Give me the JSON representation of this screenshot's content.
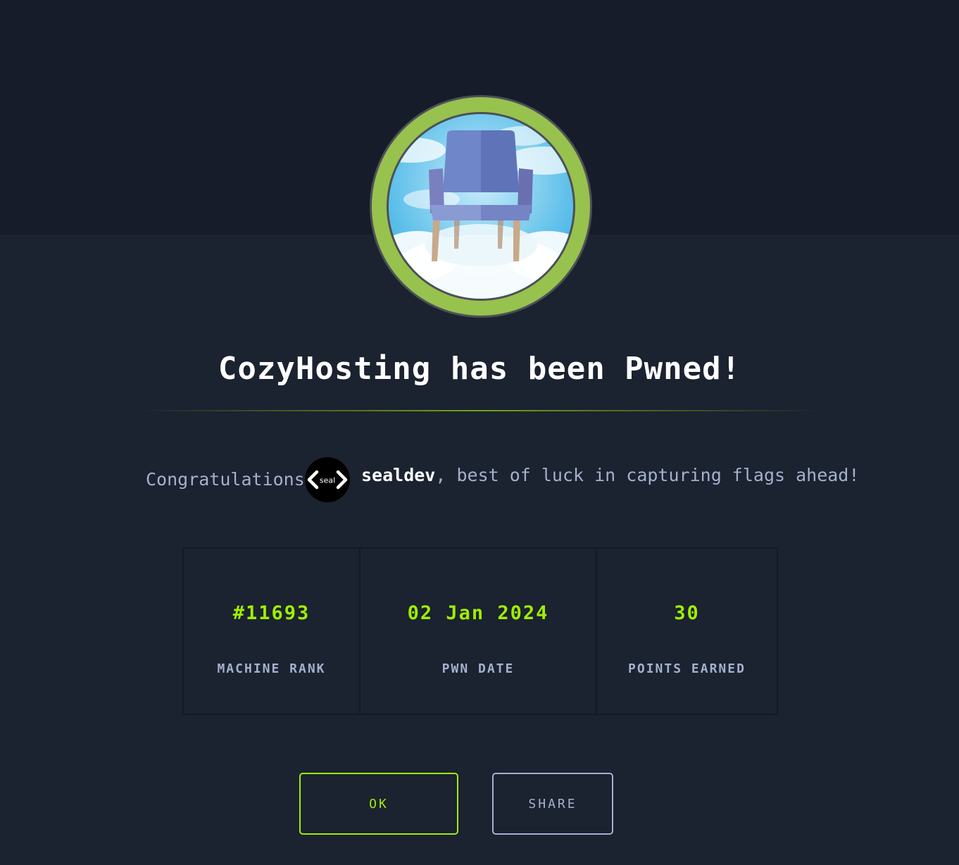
{
  "title": "CozyHosting has been Pwned!",
  "congrats": {
    "prefix": "Congratulations",
    "avatar_text": "seal",
    "username": "sealdev",
    "suffix": ", best of luck in capturing flags ahead!"
  },
  "stats": [
    {
      "value": "#11693",
      "label": "MACHINE RANK"
    },
    {
      "value": "02 Jan 2024",
      "label": "PWN DATE"
    },
    {
      "value": "30",
      "label": "POINTS EARNED"
    }
  ],
  "buttons": {
    "ok": "OK",
    "share": "SHARE"
  },
  "colors": {
    "accent": "#9fef00",
    "muted_text": "#a4b1cd",
    "background": "#1b2230",
    "header_band": "#161c29",
    "badge_ring": "#97c24e"
  }
}
